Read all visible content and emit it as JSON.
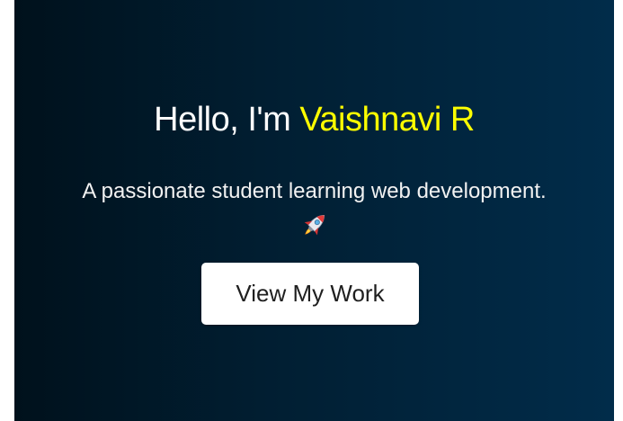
{
  "hero": {
    "greeting": "Hello, I'm ",
    "name": "Vaishnavi R",
    "tagline": "A passionate student learning web development.",
    "tagline_icon": "rocket-icon",
    "cta_label": "View My Work"
  },
  "colors": {
    "background_start": "#00111c",
    "background_end": "#012c4a",
    "name_highlight": "#ffff00",
    "text": "#ffffff",
    "button_bg": "#ffffff",
    "button_text": "#1f1f1f"
  }
}
